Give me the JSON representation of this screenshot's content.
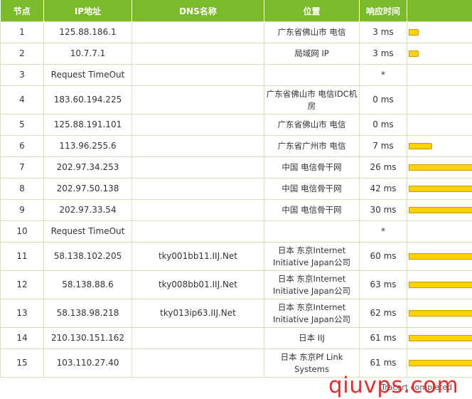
{
  "headers": [
    "节点",
    "IP地址",
    "DNS名称",
    "位置",
    "响应时间",
    ""
  ],
  "rows": [
    {
      "hop": "1",
      "ip": "125.88.186.1",
      "dns": "",
      "loc": "广东省佛山市 电信",
      "time": "3 ms",
      "ms": 3
    },
    {
      "hop": "2",
      "ip": "10.7.7.1",
      "dns": "",
      "loc": "局域网 IP",
      "time": "3 ms",
      "ms": 3
    },
    {
      "hop": "3",
      "ip": "Request TimeOut",
      "dns": "",
      "loc": "",
      "time": "*",
      "ms": 0
    },
    {
      "hop": "4",
      "ip": "183.60.194.225",
      "dns": "",
      "loc": "广东省佛山市 电信IDC机房",
      "time": "0 ms",
      "ms": 0
    },
    {
      "hop": "5",
      "ip": "125.88.191.101",
      "dns": "",
      "loc": "广东省佛山市 电信",
      "time": "0 ms",
      "ms": 0
    },
    {
      "hop": "6",
      "ip": "113.96.255.6",
      "dns": "",
      "loc": "广东省广州市 电信",
      "time": "7 ms",
      "ms": 7
    },
    {
      "hop": "7",
      "ip": "202.97.34.253",
      "dns": "",
      "loc": "中国 电信骨干网",
      "time": "26 ms",
      "ms": 26
    },
    {
      "hop": "8",
      "ip": "202.97.50.138",
      "dns": "",
      "loc": "中国 电信骨干网",
      "time": "42 ms",
      "ms": 42
    },
    {
      "hop": "9",
      "ip": "202.97.33.54",
      "dns": "",
      "loc": "中国 电信骨干网",
      "time": "30 ms",
      "ms": 30
    },
    {
      "hop": "10",
      "ip": "Request TimeOut",
      "dns": "",
      "loc": "",
      "time": "*",
      "ms": 0
    },
    {
      "hop": "11",
      "ip": "58.138.102.205",
      "dns": "tky001bb11.IIJ.Net",
      "loc": "日本 东京Internet Initiative Japan公司",
      "time": "60 ms",
      "ms": 60
    },
    {
      "hop": "12",
      "ip": "58.138.88.6",
      "dns": "tky008bb01.IIJ.Net",
      "loc": "日本 东京Internet Initiative Japan公司",
      "time": "63 ms",
      "ms": 63
    },
    {
      "hop": "13",
      "ip": "58.138.98.218",
      "dns": "tky013ip63.IIJ.Net",
      "loc": "日本 东京Internet Initiative Japan公司",
      "time": "62 ms",
      "ms": 62
    },
    {
      "hop": "14",
      "ip": "210.130.151.162",
      "dns": "",
      "loc": "日本 IIJ",
      "time": "61 ms",
      "ms": 61
    },
    {
      "hop": "15",
      "ip": "103.110.27.40",
      "dns": "",
      "loc": "日本 东京Pf Link Systems",
      "time": "61 ms",
      "ms": 61
    }
  ],
  "status": "Tracert completed",
  "watermark": "qiuvps.com",
  "colors": {
    "header": "#7bba2a",
    "bar": "#ffd200",
    "border": "#d4e3b8",
    "watermark": "#e02020"
  }
}
